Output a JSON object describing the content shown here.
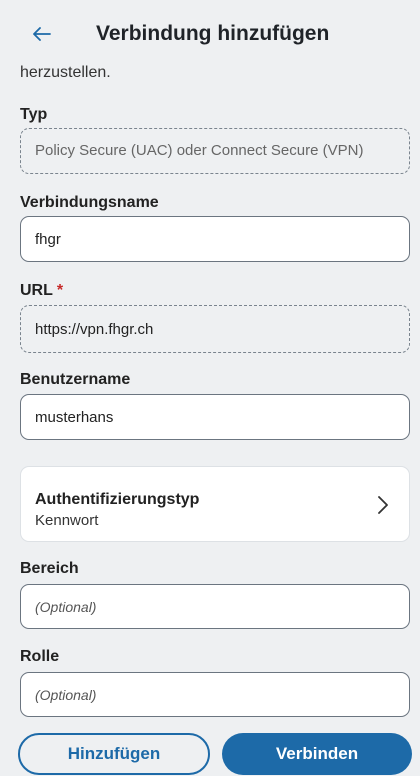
{
  "header": {
    "title": "Verbindung hinzufügen",
    "back_icon": "arrow-left-icon"
  },
  "intro_text": "herzustellen.",
  "fields": {
    "type": {
      "label": "Typ",
      "value": "Policy Secure (UAC) oder Connect Secure (VPN)"
    },
    "connection_name": {
      "label": "Verbindungsname",
      "value": "fhgr"
    },
    "url": {
      "label": "URL",
      "required_mark": "*",
      "value": "https://vpn.fhgr.ch"
    },
    "username": {
      "label": "Benutzername",
      "value": "musterhans"
    },
    "auth_type": {
      "title": "Authentifizierungstyp",
      "value": "Kennwort",
      "icon": "chevron-right-icon"
    },
    "realm": {
      "label": "Bereich",
      "placeholder": "(Optional)"
    },
    "role": {
      "label": "Rolle",
      "placeholder": "(Optional)"
    }
  },
  "actions": {
    "add_label": "Hinzufügen",
    "connect_label": "Verbinden"
  },
  "colors": {
    "accent": "#1d6aa8",
    "background": "#eef0f2",
    "required": "#c62828"
  }
}
